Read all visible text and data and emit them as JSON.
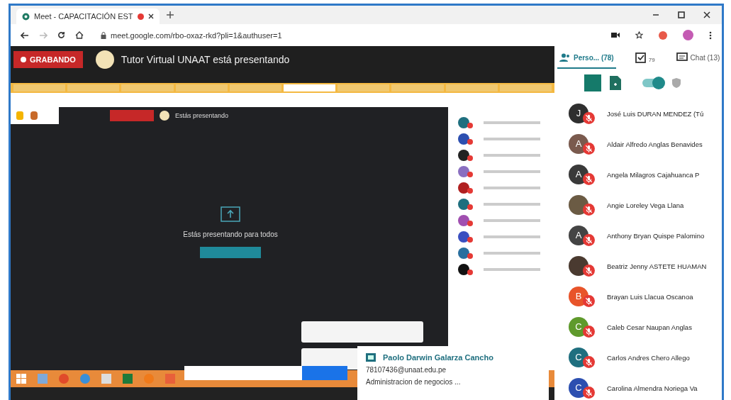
{
  "browser": {
    "tab_title": "Meet - CAPACITACIÓN EST",
    "tab_recording": true,
    "url": "meet.google.com/rbo-oxaz-rkd?pli=1&authuser=1"
  },
  "meeting": {
    "recording_label": "GRABANDO",
    "presenter_text": "Tutor Virtual UNAAT está presentando"
  },
  "shared_screen": {
    "presenting_label": "Estás presentando",
    "presenting_message": "Estás presentando para todos",
    "contact_card": {
      "name": "Paolo Darwin Galarza Cancho",
      "email": "78107436@unaat.edu.pe",
      "detail": "Administracion de negocios ..."
    }
  },
  "panel": {
    "tabs": [
      {
        "kind": "people",
        "label": "Perso... (78)",
        "selected": true
      },
      {
        "kind": "attendance",
        "label": "79",
        "selected": false
      },
      {
        "kind": "chat",
        "label": "Chat (13)",
        "selected": false
      }
    ],
    "toggle_on": true,
    "participants": [
      {
        "name": "José Luis DURAN MENDEZ (Tú",
        "initial": "J",
        "kind": "initial",
        "color": "#2f2f2f",
        "muted": true
      },
      {
        "name": "Aldair Alfredo Anglas Benavides",
        "initial": "A",
        "kind": "initial",
        "color": "#7a5a4e",
        "muted": true
      },
      {
        "name": "Angela Milagros Cajahuanca P",
        "initial": "A",
        "kind": "initial",
        "color": "#3a3a3a",
        "muted": true
      },
      {
        "name": "Angie Loreley Vega Llana",
        "kind": "photo",
        "color": "#6b5b44",
        "muted": true
      },
      {
        "name": "Anthony Bryan Quispe Palomino",
        "initial": "A",
        "kind": "initial",
        "color": "#444444",
        "muted": true
      },
      {
        "name": "Beatriz Jenny ASTETE HUAMAN",
        "kind": "photo",
        "color": "#4a3a30",
        "muted": true
      },
      {
        "name": "Brayan Luis Llacua Oscanoa",
        "initial": "B",
        "kind": "initial",
        "color": "#e8542a",
        "muted": true
      },
      {
        "name": "Caleb Cesar Naupan Anglas",
        "initial": "C",
        "kind": "initial",
        "color": "#5f9a2c",
        "muted": true
      },
      {
        "name": "Carlos Andres Chero Allego",
        "initial": "C",
        "kind": "initial",
        "color": "#1f6f7f",
        "muted": true
      },
      {
        "name": "Carolina Almendra Noriega Va",
        "initial": "C",
        "kind": "initial",
        "color": "#2c4fb0",
        "muted": true
      }
    ]
  }
}
